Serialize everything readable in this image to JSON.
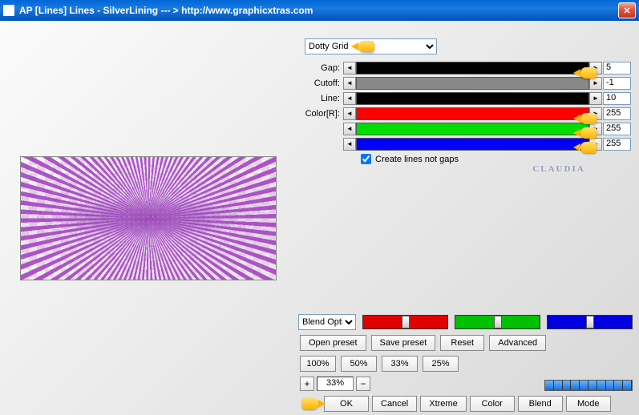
{
  "window": {
    "title": "AP [Lines] Lines - SilverLining    --- > http://www.graphicxtras.com"
  },
  "preset": {
    "selected": "Dotty Grid"
  },
  "sliders": {
    "gap": {
      "label": "Gap:",
      "value": "5"
    },
    "cutoff": {
      "label": "Cutoff:",
      "value": "-1"
    },
    "line": {
      "label": "Line:",
      "value": "10"
    },
    "colorR": {
      "label": "Color[R]:",
      "value": "255"
    },
    "colorG": {
      "label": "",
      "value": "255"
    },
    "colorB": {
      "label": "",
      "value": "255"
    }
  },
  "checkbox": {
    "create_lines": "Create lines not gaps"
  },
  "blend": {
    "dropdown": "Blend Options"
  },
  "buttons": {
    "open_preset": "Open preset",
    "save_preset": "Save preset",
    "reset": "Reset",
    "advanced": "Advanced",
    "p100": "100%",
    "p50": "50%",
    "p33": "33%",
    "p25": "25%",
    "ok": "OK",
    "cancel": "Cancel",
    "xtreme": "Xtreme",
    "color": "Color",
    "blend": "Blend",
    "mode": "Mode"
  },
  "zoom": {
    "plus": "+",
    "minus": "−",
    "value": "33%"
  },
  "watermark": "CLAUDIA"
}
